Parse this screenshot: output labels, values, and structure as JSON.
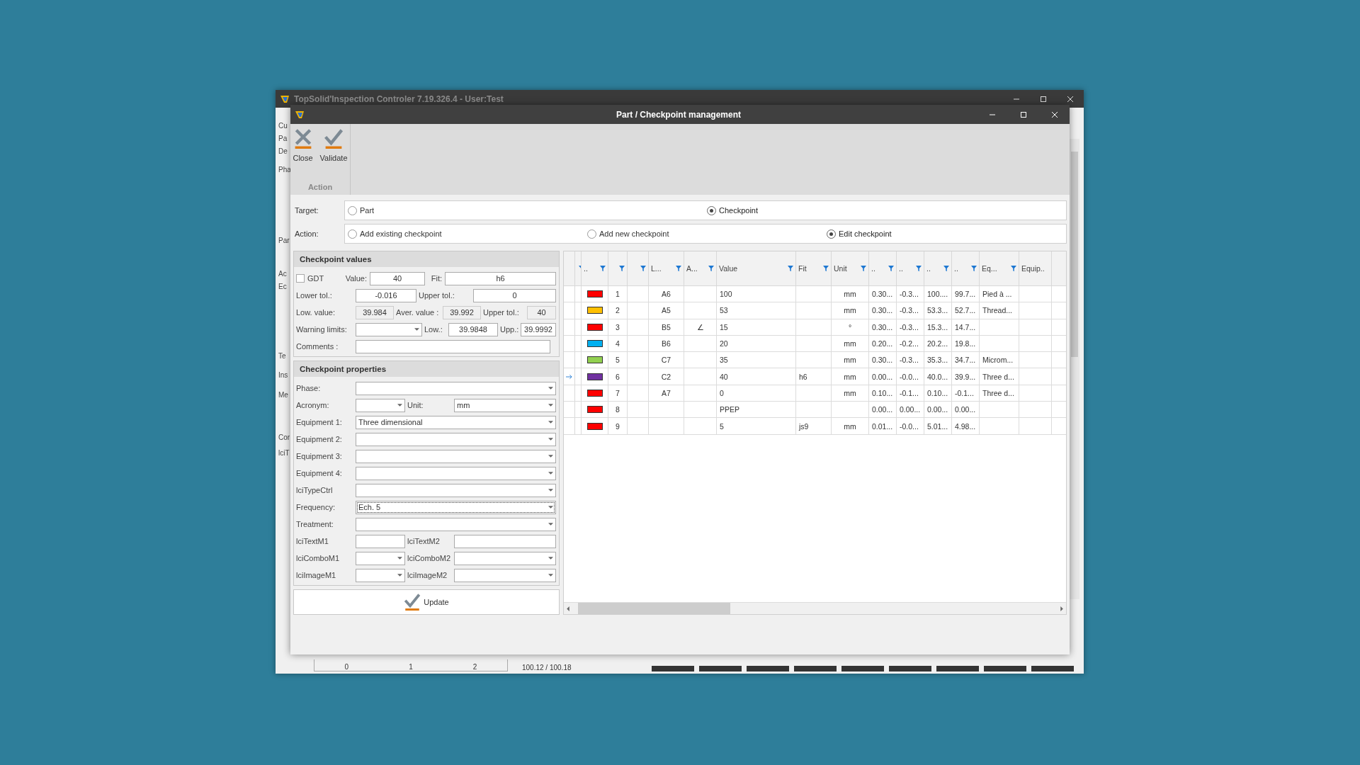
{
  "background_window": {
    "title": "TopSolid'Inspection Controler 7.19.326.4 - User:Test",
    "side_labels": [
      "Cu",
      "Pa",
      "De",
      "Pha",
      "Par",
      "Ac",
      "Ec",
      "Te",
      "Ins",
      "Me",
      "Cor",
      "lciT"
    ],
    "ruler": [
      "0",
      "1",
      "2"
    ],
    "reading": "100.12 / 100.18"
  },
  "dialog": {
    "title": "Part / Checkpoint management"
  },
  "ribbon": {
    "buttons": [
      {
        "kind": "close",
        "label": "Close"
      },
      {
        "kind": "validate",
        "label": "Validate"
      }
    ],
    "group": "Action"
  },
  "target": {
    "label": "Target:",
    "options": [
      {
        "label": "Part",
        "selected": false
      },
      {
        "label": "Checkpoint",
        "selected": true
      }
    ]
  },
  "action": {
    "label": "Action:",
    "options": [
      {
        "label": "Add existing checkpoint",
        "selected": false
      },
      {
        "label": "Add new checkpoint",
        "selected": false
      },
      {
        "label": "Edit checkpoint",
        "selected": true
      }
    ]
  },
  "checkpoint_values": {
    "title": "Checkpoint values",
    "gdt": {
      "label": "GDT",
      "checked": false
    },
    "value": {
      "label": "Value:",
      "value": "40"
    },
    "fit": {
      "label": "Fit:",
      "value": "h6"
    },
    "lower_tol": {
      "label": "Lower tol.:",
      "value": "-0.016"
    },
    "upper_tol": {
      "label": "Upper tol.:",
      "value": "0"
    },
    "low_value": {
      "label": "Low. value:",
      "value": "39.984"
    },
    "aver_value": {
      "label": "Aver. value :",
      "value": "39.992"
    },
    "upper_tol_value": {
      "label": "Upper tol.:",
      "value": "40"
    },
    "warning_limits": {
      "label": "Warning limits:"
    },
    "low": {
      "label": "Low.:",
      "value": "39.9848"
    },
    "upp": {
      "label": "Upp.:",
      "value": "39.9992"
    },
    "comments": {
      "label": "Comments :"
    }
  },
  "checkpoint_properties": {
    "title": "Checkpoint properties",
    "fields": [
      {
        "kind": "combo",
        "label": "Phase:",
        "focused": false
      },
      {
        "kind": "pair",
        "items": [
          {
            "kind": "combo",
            "label": "Acronym:",
            "focused": false
          },
          {
            "kind": "combo",
            "label": "Unit:",
            "value": "mm",
            "focused": false
          }
        ]
      },
      {
        "kind": "combo",
        "label": "Equipment 1:",
        "value": "Three dimensional",
        "focused": false
      },
      {
        "kind": "combo",
        "label": "Equipment 2:",
        "focused": false
      },
      {
        "kind": "combo",
        "label": "Equipment 3:",
        "focused": false
      },
      {
        "kind": "combo",
        "label": "Equipment 4:",
        "focused": false
      },
      {
        "kind": "combo",
        "label": "lciTypeCtrl",
        "focused": false
      },
      {
        "kind": "combo",
        "label": "Frequency:",
        "value": "Ech. 5",
        "focused": true
      },
      {
        "kind": "combo",
        "label": "Treatment:",
        "focused": false
      },
      {
        "kind": "pair",
        "items": [
          {
            "kind": "text",
            "label": "lciTextM1",
            "focused": false
          },
          {
            "kind": "text",
            "label": "lciTextM2",
            "focused": false
          }
        ]
      },
      {
        "kind": "pair",
        "items": [
          {
            "kind": "combo",
            "label": "lciComboM1",
            "focused": false
          },
          {
            "kind": "combo",
            "label": "lciComboM2",
            "focused": false
          }
        ]
      },
      {
        "kind": "pair",
        "items": [
          {
            "kind": "combo",
            "label": "lciImageM1",
            "focused": false
          },
          {
            "kind": "combo",
            "label": "lciImageM2",
            "focused": false
          }
        ]
      }
    ]
  },
  "update_button": {
    "label": "Update"
  },
  "table": {
    "columns": [
      {
        "filter": true
      },
      {
        "label": "..",
        "filter": true
      },
      {
        "filter": true
      },
      {
        "filter": true
      },
      {
        "label": "L...",
        "filter": true
      },
      {
        "label": "A...",
        "filter": true
      },
      {
        "label": "Value",
        "filter": true
      },
      {
        "label": "Fit",
        "filter": true
      },
      {
        "label": "Unit",
        "filter": true
      },
      {
        "label": "..",
        "filter": true
      },
      {
        "label": "..",
        "filter": true
      },
      {
        "label": "..",
        "filter": true
      },
      {
        "label": "..",
        "filter": true
      },
      {
        "label": "Eq...",
        "filter": true
      },
      {
        "label": "Equip..",
        "filter": false
      }
    ],
    "rows": [
      {
        "current": false,
        "color": "#ff0000",
        "number": "1",
        "l": "A6",
        "value": "100",
        "unit": "mm",
        "c1": "0.30...",
        "c2": "-0.3...",
        "c3": "100....",
        "c4": "99.7...",
        "eq": "Pied à ..."
      },
      {
        "current": false,
        "color": "#ffc000",
        "number": "2",
        "l": "A5",
        "value": "53",
        "unit": "mm",
        "c1": "0.30...",
        "c2": "-0.3...",
        "c3": "53.3...",
        "c4": "52.7...",
        "eq": "Thread..."
      },
      {
        "current": false,
        "color": "#ff0000",
        "number": "3",
        "l": "B5",
        "a": "∠",
        "value": "15",
        "unit": "°",
        "c1": "0.30...",
        "c2": "-0.3...",
        "c3": "15.3...",
        "c4": "14.7..."
      },
      {
        "current": false,
        "color": "#00b0f0",
        "number": "4",
        "l": "B6",
        "value": "20",
        "unit": "mm",
        "c1": "0.20...",
        "c2": "-0.2...",
        "c3": "20.2...",
        "c4": "19.8..."
      },
      {
        "current": false,
        "color": "#92d050",
        "number": "5",
        "l": "C7",
        "value": "35",
        "unit": "mm",
        "c1": "0.30...",
        "c2": "-0.3...",
        "c3": "35.3...",
        "c4": "34.7...",
        "eq": "Microm..."
      },
      {
        "current": true,
        "color": "#7030a0",
        "number": "6",
        "l": "C2",
        "value": "40",
        "fit": "h6",
        "unit": "mm",
        "c1": "0.00...",
        "c2": "-0.0...",
        "c3": "40.0...",
        "c4": "39.9...",
        "eq": "Three d..."
      },
      {
        "current": false,
        "color": "#ff0000",
        "number": "7",
        "l": "A7",
        "value": "0",
        "unit": "mm",
        "c1": "0.10...",
        "c2": "-0.1...",
        "c3": "0.10...",
        "c4": "-0.1...",
        "eq": "Three d..."
      },
      {
        "current": false,
        "color": "#ff0000",
        "number": "8",
        "value": "PPEP",
        "c1": "0.00...",
        "c2": "0.00...",
        "c3": "0.00...",
        "c4": "0.00..."
      },
      {
        "current": false,
        "color": "#ff0000",
        "number": "9",
        "value": "5",
        "fit": "js9",
        "unit": "mm",
        "c1": "0.01...",
        "c2": "-0.0...",
        "c3": "5.01...",
        "c4": "4.98..."
      }
    ]
  }
}
